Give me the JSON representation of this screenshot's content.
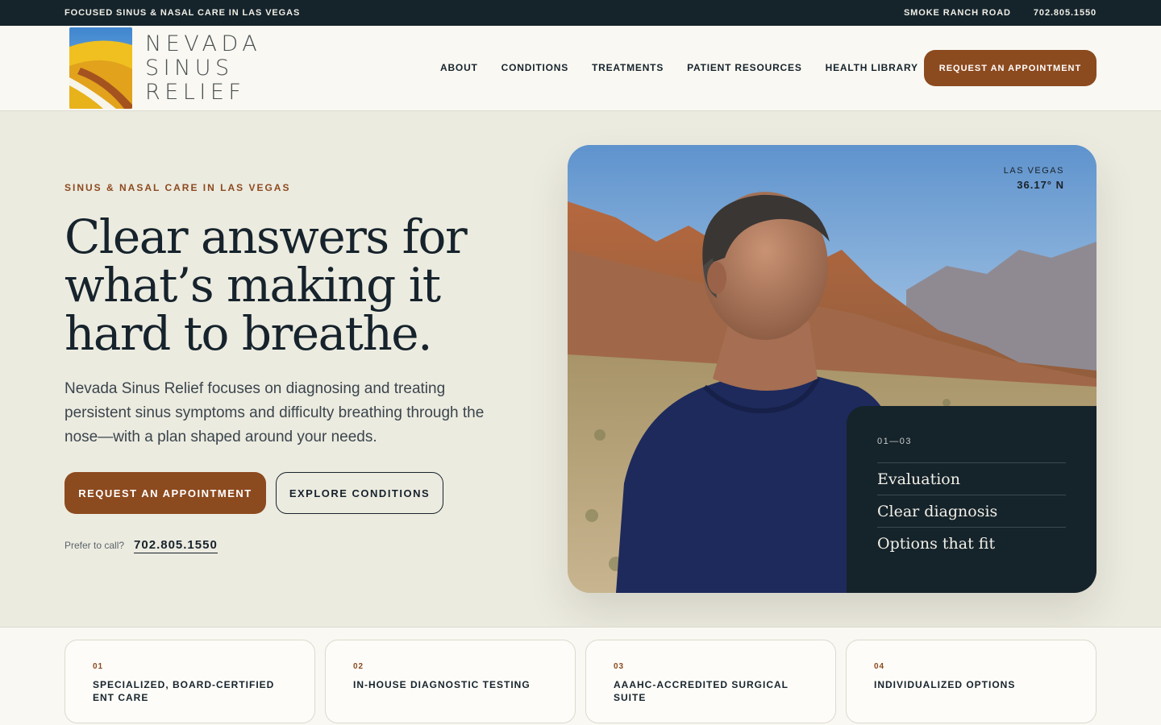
{
  "topbar": {
    "tagline": "FOCUSED SINUS & NASAL CARE IN LAS VEGAS",
    "location": "SMOKE RANCH ROAD",
    "phone": "702.805.1550"
  },
  "brand": {
    "line1": "NEVADA",
    "line2": "SINUS",
    "line3": "RELIEF",
    "colors": {
      "blue": "#4a8ed0",
      "yellow": "#e8b21a",
      "orange": "#d48a25",
      "rust": "#a4531f"
    }
  },
  "nav": {
    "items": [
      "ABOUT",
      "CONDITIONS",
      "TREATMENTS",
      "PATIENT RESOURCES",
      "HEALTH LIBRARY"
    ],
    "cta": "REQUEST AN APPOINTMENT"
  },
  "hero": {
    "eyebrow": "SINUS & NASAL CARE IN LAS VEGAS",
    "headline_line1": "Clear answers for",
    "headline_line2": "what’s making it",
    "headline_line3": "hard to breathe.",
    "lead": "Nevada Sinus Relief focuses on diagnosing and treating persistent sinus symptoms and difficulty breathing through the nose—with a plan shaped around your needs.",
    "primary_cta": "REQUEST AN APPOINTMENT",
    "secondary_cta": "EXPLORE CONDITIONS",
    "call_label": "Prefer to call?",
    "call_phone": "702.805.1550"
  },
  "card": {
    "city": "LAS VEGAS",
    "coordinate": "36.17° N",
    "steps_count": "01—03",
    "steps": [
      "Evaluation",
      "Clear diagnosis",
      "Options that fit"
    ]
  },
  "features": [
    {
      "num": "01",
      "title": "SPECIALIZED, BOARD-CERTIFIED ENT CARE"
    },
    {
      "num": "02",
      "title": "IN-HOUSE DIAGNOSTIC TESTING"
    },
    {
      "num": "03",
      "title": "AAAHC-ACCREDITED SURGICAL SUITE"
    },
    {
      "num": "04",
      "title": "INDIVIDUALIZED OPTIONS"
    }
  ],
  "theme": {
    "accent": "#8c4a1f",
    "dark": "#15232b",
    "background": "#ecebe0"
  }
}
